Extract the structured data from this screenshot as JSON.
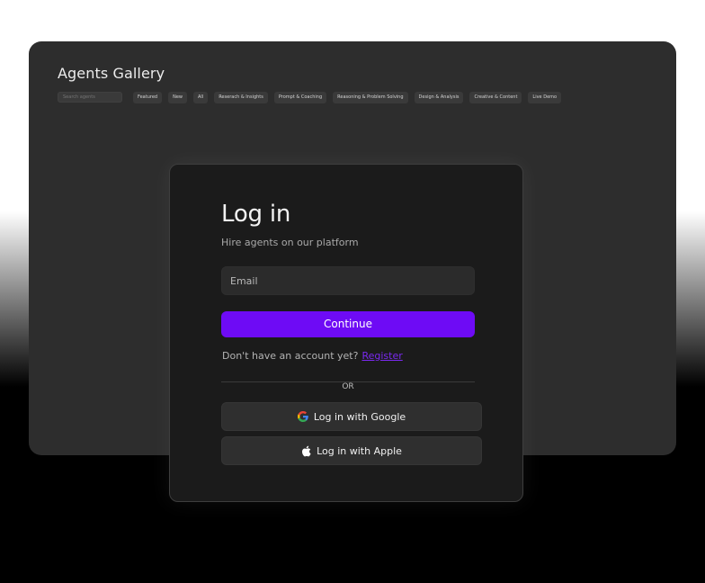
{
  "gallery": {
    "title": "Agents Gallery",
    "search_placeholder": "Search agents",
    "chips": [
      "Featured",
      "New",
      "All",
      "Reserach & Insights",
      "Prompt & Coaching",
      "Reasoning & Problem Solving",
      "Design & Analysis",
      "Creative & Content",
      "Live Demo"
    ]
  },
  "login": {
    "title": "Log in",
    "subtitle": "Hire agents on our platform",
    "email_placeholder": "Email",
    "continue_label": "Continue",
    "no_account_text": "Don't have an account yet?",
    "register_label": "Register",
    "or_text": "OR",
    "google_label": "Log in with Google",
    "apple_label": "Log in with Apple"
  },
  "colors": {
    "accent": "#6e0bf5",
    "card_bg": "#1b1b1b",
    "gallery_bg": "#2d2d2d"
  },
  "icons": {
    "google": "google-icon",
    "apple": "apple-icon"
  }
}
